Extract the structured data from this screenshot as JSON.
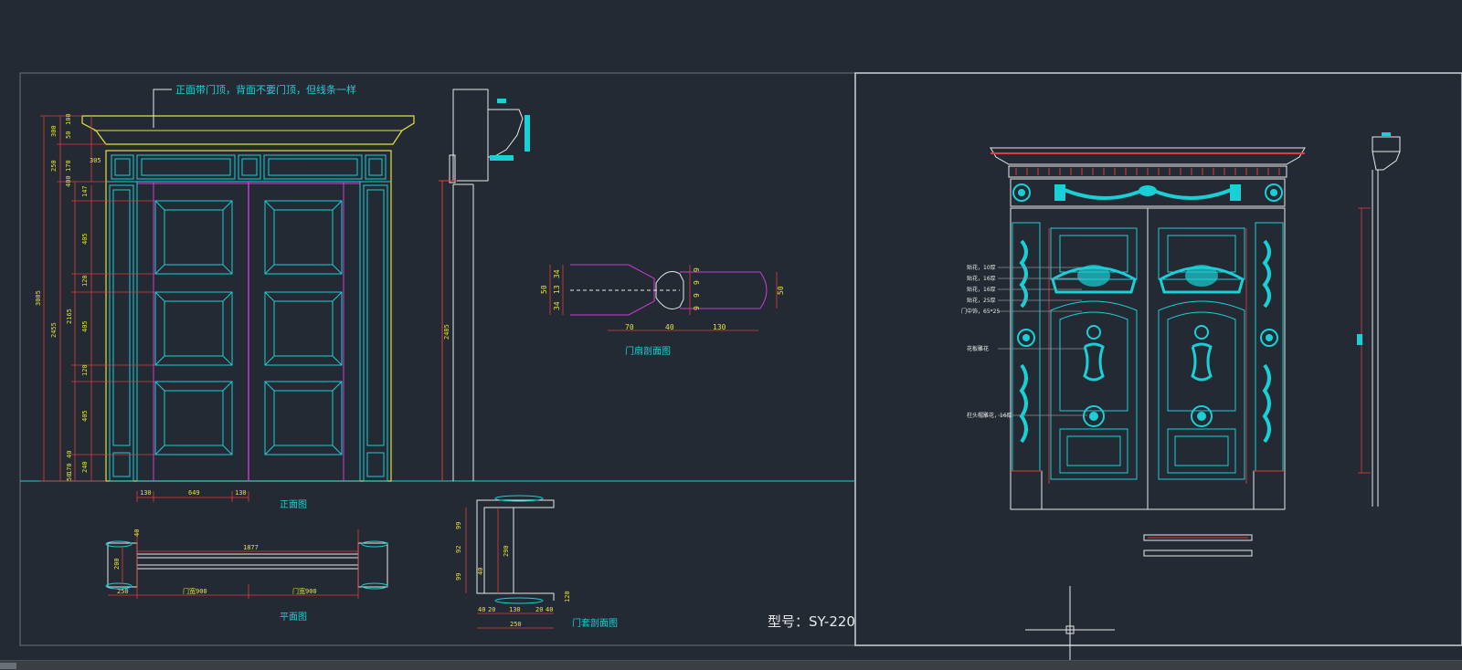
{
  "drawing": {
    "front_note": "正面带门顶，背面不要门顶，但线条一样",
    "front_view_title": "正面图",
    "plan_view_title": "平面图",
    "leaf_section_title": "门扇剖面图",
    "frame_section_title": "门套剖面图",
    "model_label": "型号：SY-220",
    "heights_left": [
      "300",
      "250",
      "400",
      "170",
      "100",
      "50",
      "3005",
      "2455",
      "2165",
      "147",
      "405",
      "120",
      "405",
      "120",
      "405",
      "40",
      "170",
      "240",
      "50"
    ],
    "front_bottom_dims": [
      "130",
      "649",
      "130"
    ],
    "plan_dims": [
      "1877",
      "250",
      "门宽900",
      "门宽900",
      "200",
      "40"
    ],
    "side_section_dim": "2485",
    "leaf_section_dims": [
      "50",
      "34",
      "13",
      "34",
      "70",
      "40",
      "130",
      "50",
      "9",
      "9",
      "9",
      "9"
    ],
    "frame_section_dims": [
      "99",
      "92",
      "99",
      "40",
      "290",
      "40",
      "20",
      "130",
      "20",
      "40",
      "250",
      "120"
    ],
    "right_annotations": [
      "贴花，10厚",
      "贴花，16厚",
      "贴花，16厚",
      "贴花，25厚",
      "门中饰，65*25",
      "花板雕花",
      "柱头帽雕花，16厚"
    ]
  },
  "colors": {
    "background": "#232a33",
    "cyan": "#19d0d6",
    "yellow": "#e7e23c",
    "magenta": "#d03ad8",
    "red": "#e23b3b",
    "white": "#e8e8e8",
    "gray_line": "#8a9099",
    "orange": "#e0a33a"
  }
}
